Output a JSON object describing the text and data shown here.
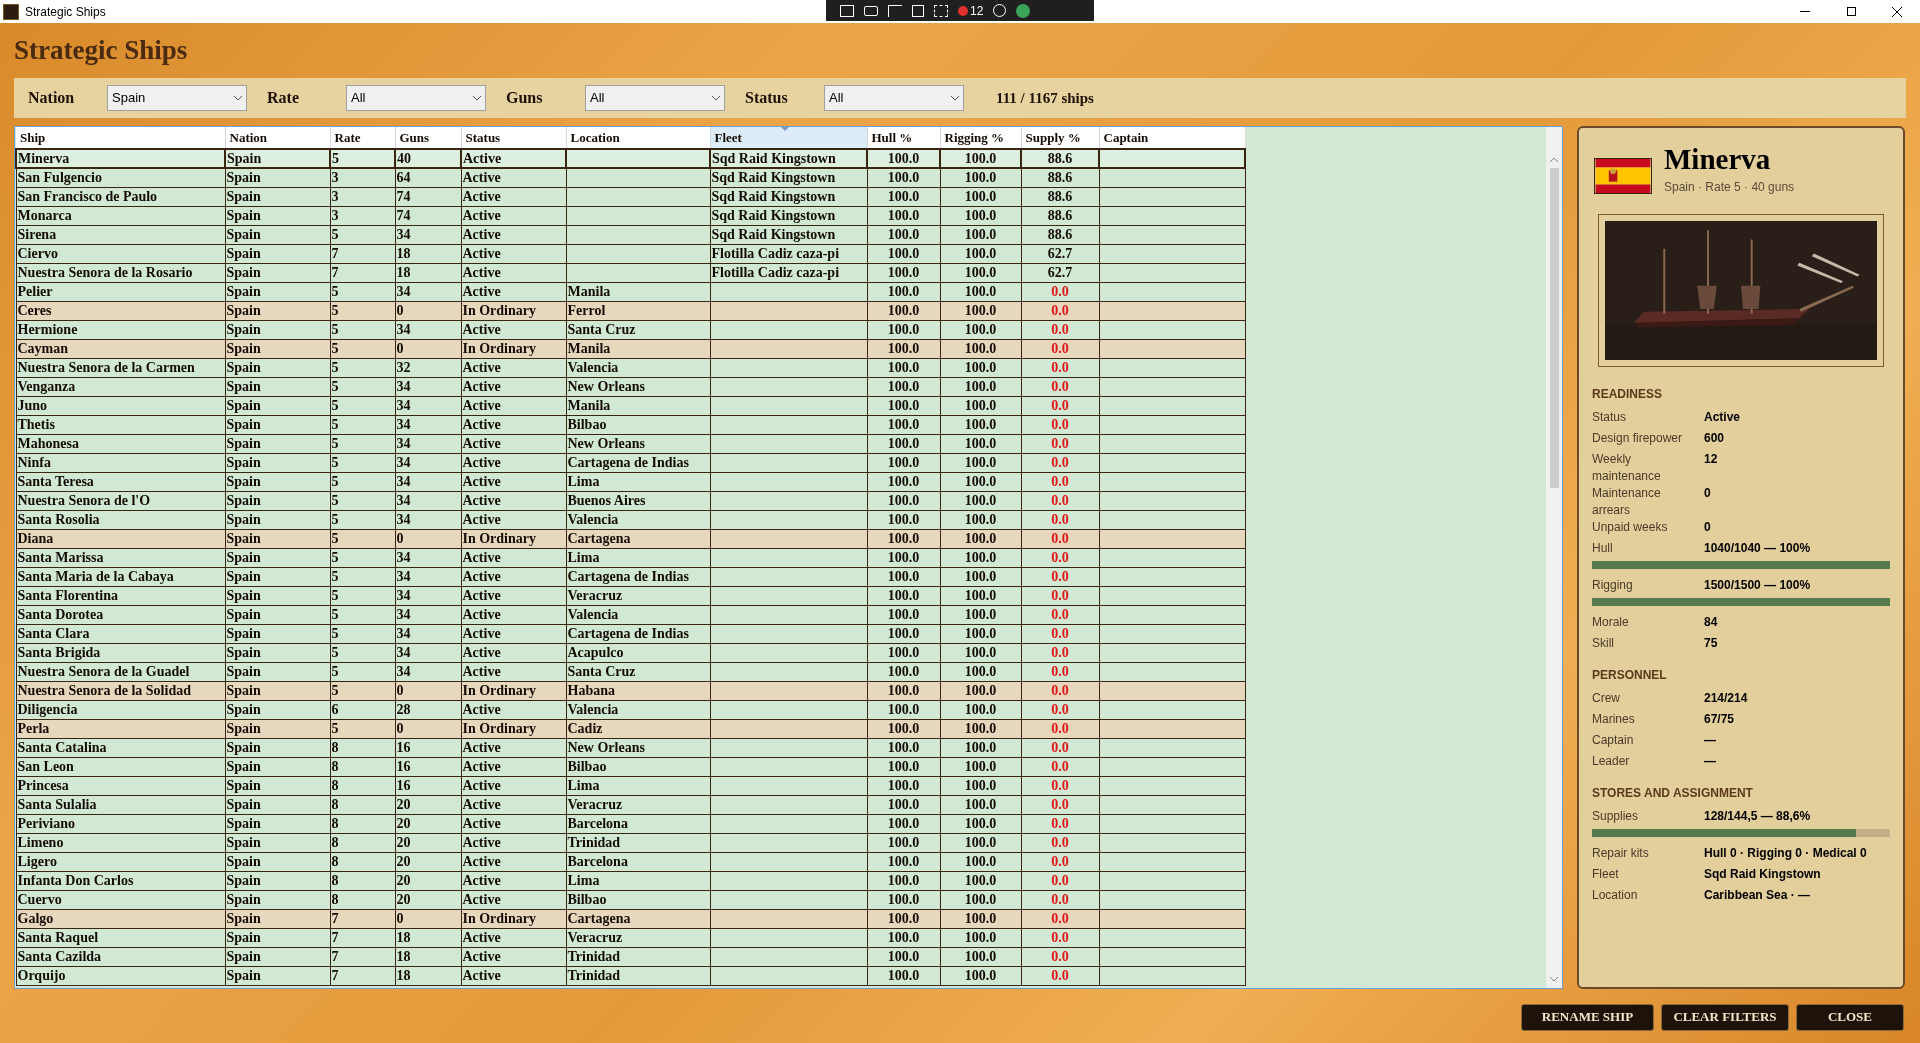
{
  "window": {
    "title": "Strategic Ships",
    "toolbar_badge": "12"
  },
  "heading": "Strategic Ships",
  "filters": [
    {
      "label": "Nation",
      "value": "Spain"
    },
    {
      "label": "Rate",
      "value": "All"
    },
    {
      "label": "Guns",
      "value": "All"
    },
    {
      "label": "Status",
      "value": "All"
    }
  ],
  "count": "111 / 1167 ships",
  "table": {
    "columns": [
      {
        "label": "Ship",
        "sorted": false
      },
      {
        "label": "Nation",
        "sorted": false
      },
      {
        "label": "Rate",
        "sorted": false
      },
      {
        "label": "Guns",
        "sorted": false
      },
      {
        "label": "Status",
        "sorted": false
      },
      {
        "label": "Location",
        "sorted": false
      },
      {
        "label": "Fleet",
        "sorted": true
      },
      {
        "label": "Hull %",
        "sorted": false
      },
      {
        "label": "Rigging %",
        "sorted": false
      },
      {
        "label": "Supply %",
        "sorted": false
      },
      {
        "label": "Captain",
        "sorted": false
      }
    ],
    "rows": [
      {
        "ship": "Minerva",
        "nation": "Spain",
        "rate": "5",
        "guns": "40",
        "status": "Active",
        "location": "",
        "fleet": "Sqd Raid Kingstown",
        "hull": "100.0",
        "rigging": "100.0",
        "supply": "88.6",
        "ordinary": false,
        "supply_low": false,
        "selected": true
      },
      {
        "ship": "San Fulgencio",
        "nation": "Spain",
        "rate": "3",
        "guns": "64",
        "status": "Active",
        "location": "",
        "fleet": "Sqd Raid Kingstown",
        "hull": "100.0",
        "rigging": "100.0",
        "supply": "88.6",
        "ordinary": false,
        "supply_low": false,
        "selected": false
      },
      {
        "ship": "San Francisco de Paulo",
        "nation": "Spain",
        "rate": "3",
        "guns": "74",
        "status": "Active",
        "location": "",
        "fleet": "Sqd Raid Kingstown",
        "hull": "100.0",
        "rigging": "100.0",
        "supply": "88.6",
        "ordinary": false,
        "supply_low": false,
        "selected": false
      },
      {
        "ship": "Monarca",
        "nation": "Spain",
        "rate": "3",
        "guns": "74",
        "status": "Active",
        "location": "",
        "fleet": "Sqd Raid Kingstown",
        "hull": "100.0",
        "rigging": "100.0",
        "supply": "88.6",
        "ordinary": false,
        "supply_low": false,
        "selected": false
      },
      {
        "ship": "Sirena",
        "nation": "Spain",
        "rate": "5",
        "guns": "34",
        "status": "Active",
        "location": "",
        "fleet": "Sqd Raid Kingstown",
        "hull": "100.0",
        "rigging": "100.0",
        "supply": "88.6",
        "ordinary": false,
        "supply_low": false,
        "selected": false
      },
      {
        "ship": "Ciervo",
        "nation": "Spain",
        "rate": "7",
        "guns": "18",
        "status": "Active",
        "location": "",
        "fleet": "Flotilla Cadiz caza-pi",
        "hull": "100.0",
        "rigging": "100.0",
        "supply": "62.7",
        "ordinary": false,
        "supply_low": false,
        "selected": false
      },
      {
        "ship": "Nuestra Senora de la Rosario",
        "nation": "Spain",
        "rate": "7",
        "guns": "18",
        "status": "Active",
        "location": "",
        "fleet": "Flotilla Cadiz caza-pi",
        "hull": "100.0",
        "rigging": "100.0",
        "supply": "62.7",
        "ordinary": false,
        "supply_low": false,
        "selected": false
      },
      {
        "ship": "Pelier",
        "nation": "Spain",
        "rate": "5",
        "guns": "34",
        "status": "Active",
        "location": "Manila",
        "fleet": "",
        "hull": "100.0",
        "rigging": "100.0",
        "supply": "0.0",
        "ordinary": false,
        "supply_low": true,
        "selected": false
      },
      {
        "ship": "Ceres",
        "nation": "Spain",
        "rate": "5",
        "guns": "0",
        "status": "In Ordinary",
        "location": "Ferrol",
        "fleet": "",
        "hull": "100.0",
        "rigging": "100.0",
        "supply": "0.0",
        "ordinary": true,
        "supply_low": true,
        "selected": false
      },
      {
        "ship": "Hermione",
        "nation": "Spain",
        "rate": "5",
        "guns": "34",
        "status": "Active",
        "location": "Santa Cruz",
        "fleet": "",
        "hull": "100.0",
        "rigging": "100.0",
        "supply": "0.0",
        "ordinary": false,
        "supply_low": true,
        "selected": false
      },
      {
        "ship": "Cayman",
        "nation": "Spain",
        "rate": "5",
        "guns": "0",
        "status": "In Ordinary",
        "location": "Manila",
        "fleet": "",
        "hull": "100.0",
        "rigging": "100.0",
        "supply": "0.0",
        "ordinary": true,
        "supply_low": true,
        "selected": false
      },
      {
        "ship": "Nuestra Senora de la Carmen",
        "nation": "Spain",
        "rate": "5",
        "guns": "32",
        "status": "Active",
        "location": "Valencia",
        "fleet": "",
        "hull": "100.0",
        "rigging": "100.0",
        "supply": "0.0",
        "ordinary": false,
        "supply_low": true,
        "selected": false
      },
      {
        "ship": "Venganza",
        "nation": "Spain",
        "rate": "5",
        "guns": "34",
        "status": "Active",
        "location": "New Orleans",
        "fleet": "",
        "hull": "100.0",
        "rigging": "100.0",
        "supply": "0.0",
        "ordinary": false,
        "supply_low": true,
        "selected": false
      },
      {
        "ship": "Juno",
        "nation": "Spain",
        "rate": "5",
        "guns": "34",
        "status": "Active",
        "location": "Manila",
        "fleet": "",
        "hull": "100.0",
        "rigging": "100.0",
        "supply": "0.0",
        "ordinary": false,
        "supply_low": true,
        "selected": false
      },
      {
        "ship": "Thetis",
        "nation": "Spain",
        "rate": "5",
        "guns": "34",
        "status": "Active",
        "location": "Bilbao",
        "fleet": "",
        "hull": "100.0",
        "rigging": "100.0",
        "supply": "0.0",
        "ordinary": false,
        "supply_low": true,
        "selected": false
      },
      {
        "ship": "Mahonesa",
        "nation": "Spain",
        "rate": "5",
        "guns": "34",
        "status": "Active",
        "location": "New Orleans",
        "fleet": "",
        "hull": "100.0",
        "rigging": "100.0",
        "supply": "0.0",
        "ordinary": false,
        "supply_low": true,
        "selected": false
      },
      {
        "ship": "Ninfa",
        "nation": "Spain",
        "rate": "5",
        "guns": "34",
        "status": "Active",
        "location": "Cartagena de Indias",
        "fleet": "",
        "hull": "100.0",
        "rigging": "100.0",
        "supply": "0.0",
        "ordinary": false,
        "supply_low": true,
        "selected": false
      },
      {
        "ship": "Santa Teresa",
        "nation": "Spain",
        "rate": "5",
        "guns": "34",
        "status": "Active",
        "location": "Lima",
        "fleet": "",
        "hull": "100.0",
        "rigging": "100.0",
        "supply": "0.0",
        "ordinary": false,
        "supply_low": true,
        "selected": false
      },
      {
        "ship": "Nuestra Senora de l'O",
        "nation": "Spain",
        "rate": "5",
        "guns": "34",
        "status": "Active",
        "location": "Buenos Aires",
        "fleet": "",
        "hull": "100.0",
        "rigging": "100.0",
        "supply": "0.0",
        "ordinary": false,
        "supply_low": true,
        "selected": false
      },
      {
        "ship": "Santa Rosolia",
        "nation": "Spain",
        "rate": "5",
        "guns": "34",
        "status": "Active",
        "location": "Valencia",
        "fleet": "",
        "hull": "100.0",
        "rigging": "100.0",
        "supply": "0.0",
        "ordinary": false,
        "supply_low": true,
        "selected": false
      },
      {
        "ship": "Diana",
        "nation": "Spain",
        "rate": "5",
        "guns": "0",
        "status": "In Ordinary",
        "location": "Cartagena",
        "fleet": "",
        "hull": "100.0",
        "rigging": "100.0",
        "supply": "0.0",
        "ordinary": true,
        "supply_low": true,
        "selected": false
      },
      {
        "ship": "Santa Marissa",
        "nation": "Spain",
        "rate": "5",
        "guns": "34",
        "status": "Active",
        "location": "Lima",
        "fleet": "",
        "hull": "100.0",
        "rigging": "100.0",
        "supply": "0.0",
        "ordinary": false,
        "supply_low": true,
        "selected": false
      },
      {
        "ship": "Santa Maria de la Cabaya",
        "nation": "Spain",
        "rate": "5",
        "guns": "34",
        "status": "Active",
        "location": "Cartagena de Indias",
        "fleet": "",
        "hull": "100.0",
        "rigging": "100.0",
        "supply": "0.0",
        "ordinary": false,
        "supply_low": true,
        "selected": false
      },
      {
        "ship": "Santa Florentina",
        "nation": "Spain",
        "rate": "5",
        "guns": "34",
        "status": "Active",
        "location": "Veracruz",
        "fleet": "",
        "hull": "100.0",
        "rigging": "100.0",
        "supply": "0.0",
        "ordinary": false,
        "supply_low": true,
        "selected": false
      },
      {
        "ship": "Santa Dorotea",
        "nation": "Spain",
        "rate": "5",
        "guns": "34",
        "status": "Active",
        "location": "Valencia",
        "fleet": "",
        "hull": "100.0",
        "rigging": "100.0",
        "supply": "0.0",
        "ordinary": false,
        "supply_low": true,
        "selected": false
      },
      {
        "ship": "Santa Clara",
        "nation": "Spain",
        "rate": "5",
        "guns": "34",
        "status": "Active",
        "location": "Cartagena de Indias",
        "fleet": "",
        "hull": "100.0",
        "rigging": "100.0",
        "supply": "0.0",
        "ordinary": false,
        "supply_low": true,
        "selected": false
      },
      {
        "ship": "Santa Brigida",
        "nation": "Spain",
        "rate": "5",
        "guns": "34",
        "status": "Active",
        "location": "Acapulco",
        "fleet": "",
        "hull": "100.0",
        "rigging": "100.0",
        "supply": "0.0",
        "ordinary": false,
        "supply_low": true,
        "selected": false
      },
      {
        "ship": "Nuestra Senora de la Guadel",
        "nation": "Spain",
        "rate": "5",
        "guns": "34",
        "status": "Active",
        "location": "Santa Cruz",
        "fleet": "",
        "hull": "100.0",
        "rigging": "100.0",
        "supply": "0.0",
        "ordinary": false,
        "supply_low": true,
        "selected": false
      },
      {
        "ship": "Nuestra Senora de la Solidad",
        "nation": "Spain",
        "rate": "5",
        "guns": "0",
        "status": "In Ordinary",
        "location": "Habana",
        "fleet": "",
        "hull": "100.0",
        "rigging": "100.0",
        "supply": "0.0",
        "ordinary": true,
        "supply_low": true,
        "selected": false
      },
      {
        "ship": "Diligencia",
        "nation": "Spain",
        "rate": "6",
        "guns": "28",
        "status": "Active",
        "location": "Valencia",
        "fleet": "",
        "hull": "100.0",
        "rigging": "100.0",
        "supply": "0.0",
        "ordinary": false,
        "supply_low": true,
        "selected": false
      },
      {
        "ship": "Perla",
        "nation": "Spain",
        "rate": "5",
        "guns": "0",
        "status": "In Ordinary",
        "location": "Cadiz",
        "fleet": "",
        "hull": "100.0",
        "rigging": "100.0",
        "supply": "0.0",
        "ordinary": true,
        "supply_low": true,
        "selected": false
      },
      {
        "ship": "Santa Catalina",
        "nation": "Spain",
        "rate": "8",
        "guns": "16",
        "status": "Active",
        "location": "New Orleans",
        "fleet": "",
        "hull": "100.0",
        "rigging": "100.0",
        "supply": "0.0",
        "ordinary": false,
        "supply_low": true,
        "selected": false
      },
      {
        "ship": "San Leon",
        "nation": "Spain",
        "rate": "8",
        "guns": "16",
        "status": "Active",
        "location": "Bilbao",
        "fleet": "",
        "hull": "100.0",
        "rigging": "100.0",
        "supply": "0.0",
        "ordinary": false,
        "supply_low": true,
        "selected": false
      },
      {
        "ship": "Princesa",
        "nation": "Spain",
        "rate": "8",
        "guns": "16",
        "status": "Active",
        "location": "Lima",
        "fleet": "",
        "hull": "100.0",
        "rigging": "100.0",
        "supply": "0.0",
        "ordinary": false,
        "supply_low": true,
        "selected": false
      },
      {
        "ship": "Santa Sulalia",
        "nation": "Spain",
        "rate": "8",
        "guns": "20",
        "status": "Active",
        "location": "Veracruz",
        "fleet": "",
        "hull": "100.0",
        "rigging": "100.0",
        "supply": "0.0",
        "ordinary": false,
        "supply_low": true,
        "selected": false
      },
      {
        "ship": "Periviano",
        "nation": "Spain",
        "rate": "8",
        "guns": "20",
        "status": "Active",
        "location": "Barcelona",
        "fleet": "",
        "hull": "100.0",
        "rigging": "100.0",
        "supply": "0.0",
        "ordinary": false,
        "supply_low": true,
        "selected": false
      },
      {
        "ship": "Limeno",
        "nation": "Spain",
        "rate": "8",
        "guns": "20",
        "status": "Active",
        "location": "Trinidad",
        "fleet": "",
        "hull": "100.0",
        "rigging": "100.0",
        "supply": "0.0",
        "ordinary": false,
        "supply_low": true,
        "selected": false
      },
      {
        "ship": "Ligero",
        "nation": "Spain",
        "rate": "8",
        "guns": "20",
        "status": "Active",
        "location": "Barcelona",
        "fleet": "",
        "hull": "100.0",
        "rigging": "100.0",
        "supply": "0.0",
        "ordinary": false,
        "supply_low": true,
        "selected": false
      },
      {
        "ship": "Infanta Don Carlos",
        "nation": "Spain",
        "rate": "8",
        "guns": "20",
        "status": "Active",
        "location": "Lima",
        "fleet": "",
        "hull": "100.0",
        "rigging": "100.0",
        "supply": "0.0",
        "ordinary": false,
        "supply_low": true,
        "selected": false
      },
      {
        "ship": "Cuervo",
        "nation": "Spain",
        "rate": "8",
        "guns": "20",
        "status": "Active",
        "location": "Bilbao",
        "fleet": "",
        "hull": "100.0",
        "rigging": "100.0",
        "supply": "0.0",
        "ordinary": false,
        "supply_low": true,
        "selected": false
      },
      {
        "ship": "Galgo",
        "nation": "Spain",
        "rate": "7",
        "guns": "0",
        "status": "In Ordinary",
        "location": "Cartagena",
        "fleet": "",
        "hull": "100.0",
        "rigging": "100.0",
        "supply": "0.0",
        "ordinary": true,
        "supply_low": true,
        "selected": false
      },
      {
        "ship": "Santa Raquel",
        "nation": "Spain",
        "rate": "7",
        "guns": "18",
        "status": "Active",
        "location": "Veracruz",
        "fleet": "",
        "hull": "100.0",
        "rigging": "100.0",
        "supply": "0.0",
        "ordinary": false,
        "supply_low": true,
        "selected": false
      },
      {
        "ship": "Santa Cazilda",
        "nation": "Spain",
        "rate": "7",
        "guns": "18",
        "status": "Active",
        "location": "Trinidad",
        "fleet": "",
        "hull": "100.0",
        "rigging": "100.0",
        "supply": "0.0",
        "ordinary": false,
        "supply_low": true,
        "selected": false
      },
      {
        "ship": "Orquijo",
        "nation": "Spain",
        "rate": "7",
        "guns": "18",
        "status": "Active",
        "location": "Trinidad",
        "fleet": "",
        "hull": "100.0",
        "rigging": "100.0",
        "supply": "0.0",
        "ordinary": false,
        "supply_low": true,
        "selected": false
      }
    ]
  },
  "detail": {
    "name": "Minerva",
    "subtitle": "Spain · Rate 5 · 40 guns",
    "sections": [
      {
        "title": "READINESS",
        "fields": [
          {
            "kind": "text",
            "label": "Status",
            "value": "Active"
          },
          {
            "kind": "text",
            "label": "Design firepower",
            "value": "600"
          },
          {
            "kind": "text",
            "label": "Weekly maintenance",
            "value": "12"
          },
          {
            "kind": "text",
            "label": "Maintenance arrears",
            "value": "0"
          },
          {
            "kind": "text",
            "label": "Unpaid weeks",
            "value": "0"
          },
          {
            "kind": "meter",
            "label": "Hull",
            "value": "1040/1040 — 100%",
            "level": 1.0
          },
          {
            "kind": "meter",
            "label": "Rigging",
            "value": "1500/1500 — 100%",
            "level": 1.0
          },
          {
            "kind": "text",
            "label": "Morale",
            "value": "84"
          },
          {
            "kind": "text",
            "label": "Skill",
            "value": "75"
          }
        ]
      },
      {
        "title": "PERSONNEL",
        "fields": [
          {
            "kind": "text",
            "label": "Crew",
            "value": "214/214"
          },
          {
            "kind": "text",
            "label": "Marines",
            "value": "67/75"
          },
          {
            "kind": "text",
            "label": "Captain",
            "value": "—"
          },
          {
            "kind": "text",
            "label": "Leader",
            "value": "—"
          }
        ]
      },
      {
        "title": "STORES AND ASSIGNMENT",
        "fields": [
          {
            "kind": "meter",
            "label": "Supplies",
            "value": "128/144,5 — 88,6%",
            "level": 0.886
          },
          {
            "kind": "text",
            "label": "Repair kits",
            "value": "Hull 0 · Rigging 0 · Medical 0"
          },
          {
            "kind": "text",
            "label": "Fleet",
            "value": "Sqd Raid Kingstown"
          },
          {
            "kind": "text",
            "label": "Location",
            "value": "Caribbean Sea · —"
          }
        ]
      }
    ]
  },
  "buttons": [
    "RENAME SHIP",
    "CLEAR FILTERS",
    "CLOSE"
  ]
}
